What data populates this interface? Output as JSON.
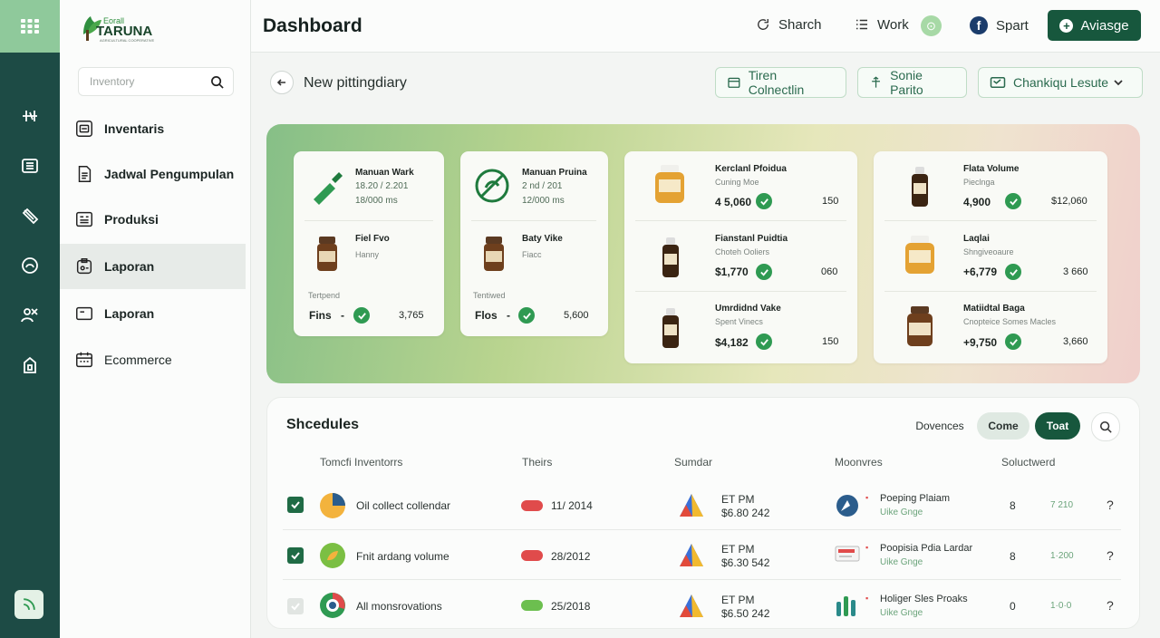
{
  "app": {
    "logo_small": "Eorall",
    "logo_name": "TARUNA",
    "logo_tagline": "AGRICULTURAL COOPERATIVE"
  },
  "header": {
    "title": "Dashboard",
    "links": [
      "Sharch",
      "Work",
      "Spart"
    ],
    "dot_label": "⊙",
    "primary_label": "Aviasge"
  },
  "sidebar": {
    "search_placeholder": "Inventory",
    "items": [
      {
        "label": "Inventaris"
      },
      {
        "label": "Jadwal Pengumpulan"
      },
      {
        "label": "Produksi"
      },
      {
        "label": "Laporan"
      },
      {
        "label": "Laporan"
      },
      {
        "label": "Ecommerce"
      }
    ]
  },
  "subheader": {
    "title": "New pittingdiary",
    "chips": [
      "Tiren Colnectlin",
      "Sonie Parito",
      "Chankiqu Lesute"
    ]
  },
  "hero": {
    "cards": [
      {
        "top_title": "Manuan Wark",
        "top_line1": "18.20 / 2.201",
        "top_line2": "18/000 ms",
        "mid_title": "Fiel Fvo",
        "mid_sub": "Hanny",
        "foot_label": "Tertpend",
        "foot_name": "Fins",
        "foot_sep": "-",
        "foot_value": "3,765"
      },
      {
        "top_title": "Manuan Pruina",
        "top_line1": "2 nd / 201",
        "top_line2": "12/000 ms",
        "mid_title": "Baty Vike",
        "mid_sub": "Fiacc",
        "foot_label": "Tentiwed",
        "foot_name": "Flos",
        "foot_sep": "-",
        "foot_value": "5,600"
      }
    ],
    "products_left": [
      {
        "name": "Kerclanl Pfoidua",
        "sub": "Cuning Moe",
        "price": "4 5,060",
        "qty": "150"
      },
      {
        "name": "Fianstanl Puidtia",
        "sub": "Choteh Ooliers",
        "price": "$1,770",
        "qty": "060"
      },
      {
        "name": "Umrdidnd Vake",
        "sub": "Spent Vinecs",
        "price": "$4,182",
        "qty": "150"
      }
    ],
    "products_right": [
      {
        "name": "Flata Volume",
        "sub": "Pieclnga",
        "price": "4,900",
        "qty": "$12,060"
      },
      {
        "name": "Laqlai",
        "sub": "Shngiveoaure",
        "price": "+6,779",
        "qty": "3 660"
      },
      {
        "name": "Matiidtal Baga",
        "sub": "Cnopteice Somes Macles",
        "price": "+9,750",
        "qty": "3,660"
      }
    ]
  },
  "schedules": {
    "title": "Shcedules",
    "filters": [
      "Dovences",
      "Come",
      "Toat"
    ],
    "headers": [
      "Tomcfi Inventorrs",
      "Theirs",
      "Sumdar",
      "Moonvres",
      "Soluctwerd"
    ],
    "rows": [
      {
        "checked": true,
        "name": "Oil collect collendar",
        "date": "11/ 2014",
        "time": "ET PM",
        "amount": "$6.80 242",
        "move_title": "Poeping Plaiam",
        "move_sub": "Uike Gnge",
        "count": "8",
        "val": "7 210",
        "q": "?",
        "pill_color": "#e04b4b"
      },
      {
        "checked": true,
        "name": "Fnit ardang volume",
        "date": "28/2012",
        "time": "ET PM",
        "amount": "$6.30 542",
        "move_title": "Poopisia Pdia Lardar",
        "move_sub": "Uike Gnge",
        "count": "8",
        "val": "1·200",
        "q": "?",
        "pill_color": "#e04b4b"
      },
      {
        "checked": false,
        "name": "All monsrovations",
        "date": "25/2018",
        "time": "ET PM",
        "amount": "$6.50 242",
        "move_title": "Holiger Sles Proaks",
        "move_sub": "Uike Gnge",
        "count": "0",
        "val": "1·0·0",
        "q": "?",
        "pill_color": "#6cbf4f"
      }
    ]
  },
  "colors": {
    "brand": "#17573d",
    "rail": "#1d4b45",
    "accent": "#2f9a52"
  }
}
